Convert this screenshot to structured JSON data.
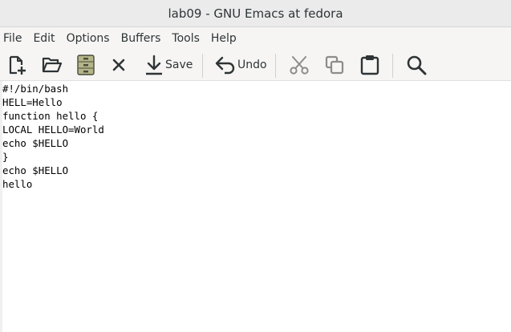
{
  "window": {
    "title": "lab09 - GNU Emacs at fedora"
  },
  "menubar": {
    "items": [
      "File",
      "Edit",
      "Options",
      "Buffers",
      "Tools",
      "Help"
    ]
  },
  "toolbar": {
    "buttons": [
      {
        "name": "new-file",
        "icon": "new-file-icon",
        "label": ""
      },
      {
        "name": "open-folder",
        "icon": "folder-open-icon",
        "label": ""
      },
      {
        "name": "dired",
        "icon": "file-cabinet-icon",
        "label": ""
      },
      {
        "name": "close",
        "icon": "close-icon",
        "label": ""
      },
      {
        "name": "save",
        "icon": "download-icon",
        "label": "Save"
      },
      {
        "name": "undo",
        "icon": "undo-icon",
        "label": "Undo"
      },
      {
        "name": "cut",
        "icon": "scissors-icon",
        "label": ""
      },
      {
        "name": "copy",
        "icon": "copy-icon",
        "label": ""
      },
      {
        "name": "paste",
        "icon": "clipboard-icon",
        "label": ""
      },
      {
        "name": "search",
        "icon": "search-icon",
        "label": ""
      }
    ]
  },
  "editor": {
    "lines": [
      "#!/bin/bash",
      "HELL=Hello",
      "function hello {",
      "LOCAL HELLO=World",
      "echo $HELLO",
      "}",
      "echo $HELLO",
      "hello"
    ]
  },
  "colors": {
    "titlebar_bg": "#ebebeb",
    "toolbar_bg": "#f6f5f4",
    "icon_color": "#2e3436",
    "disabled_icon_color": "#8c8c8c",
    "dired_icon_fill": "#b5b58a"
  }
}
